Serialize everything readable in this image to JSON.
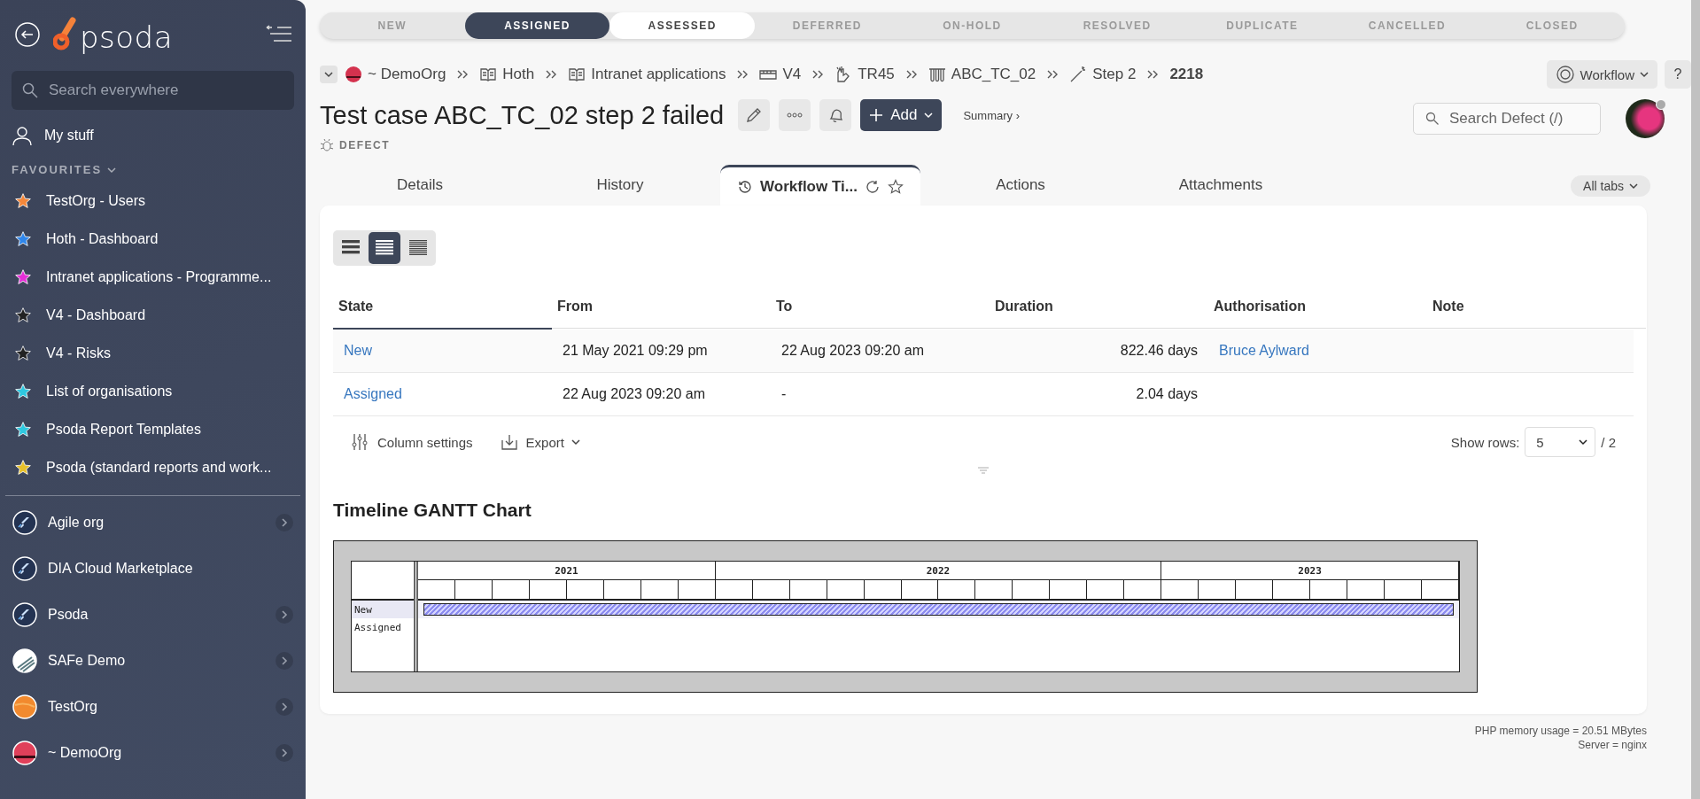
{
  "sidebar": {
    "logo": "psoda",
    "search": {
      "placeholder": "Search everywhere"
    },
    "my_stuff": "My stuff",
    "favourites_heading": "FAVOURITES",
    "favourites": [
      {
        "label": "TestOrg - Users",
        "color": "#f5873a"
      },
      {
        "label": "Hoth - Dashboard",
        "color": "#2f86eb"
      },
      {
        "label": "Intranet applications - Programme...",
        "color": "#e62ed8"
      },
      {
        "label": "V4 - Dashboard",
        "color": "#222222"
      },
      {
        "label": "V4 - Risks",
        "color": "#222222"
      },
      {
        "label": "List of organisations",
        "color": "#2ec8e0"
      },
      {
        "label": "Psoda Report Templates",
        "color": "#2ec8e0"
      },
      {
        "label": "Psoda (standard reports and work...",
        "color": "#e8c12a"
      }
    ],
    "organisations": [
      {
        "label": "Agile org",
        "kind": "rocket",
        "expandable": true
      },
      {
        "label": "DIA Cloud Marketplace",
        "kind": "rocket",
        "expandable": false
      },
      {
        "label": "Psoda",
        "kind": "rocket",
        "expandable": true
      },
      {
        "label": "SAFe Demo",
        "kind": "stripes",
        "expandable": true
      },
      {
        "label": "TestOrg",
        "kind": "orange",
        "expandable": true
      },
      {
        "label": "~ DemoOrg",
        "kind": "sunset",
        "expandable": true
      }
    ]
  },
  "workflow_steps": [
    {
      "label": "NEW",
      "kind": "past"
    },
    {
      "label": "ASSIGNED",
      "kind": "current"
    },
    {
      "label": "ASSESSED",
      "kind": "next"
    },
    {
      "label": "DEFERRED",
      "kind": "future"
    },
    {
      "label": "ON-HOLD",
      "kind": "future"
    },
    {
      "label": "RESOLVED",
      "kind": "future"
    },
    {
      "label": "DUPLICATE",
      "kind": "future"
    },
    {
      "label": "CANCELLED",
      "kind": "future"
    },
    {
      "label": "CLOSED",
      "kind": "future"
    }
  ],
  "breadcrumbs": [
    {
      "label": "~ DemoOrg",
      "kind": "org"
    },
    {
      "label": "Hoth",
      "kind": "book"
    },
    {
      "label": "Intranet applications",
      "kind": "book"
    },
    {
      "label": "V4",
      "kind": "board"
    },
    {
      "label": "TR45",
      "kind": "hand"
    },
    {
      "label": "ABC_TC_02",
      "kind": "tubes"
    },
    {
      "label": "Step 2",
      "kind": "wand"
    },
    {
      "label": "2218",
      "kind": "current"
    }
  ],
  "header": {
    "title": "Test case ABC_TC_02 step 2 failed",
    "type_label": "DEFECT",
    "add_button": "Add",
    "summary_link": "Summary ›",
    "workflow_button": "Workflow",
    "help_button": "?",
    "search": {
      "placeholder": "Search Defect (/)"
    }
  },
  "tabs": [
    {
      "label": "Details",
      "selected": false
    },
    {
      "label": "History",
      "selected": false
    },
    {
      "label": "Workflow Ti...",
      "selected": true
    },
    {
      "label": "Actions",
      "selected": false
    },
    {
      "label": "Attachments",
      "selected": false
    }
  ],
  "all_tabs_button": "All tabs",
  "view_modes": [
    {
      "selected": false
    },
    {
      "selected": true
    },
    {
      "selected": false
    }
  ],
  "table": {
    "columns": [
      "State",
      "From",
      "To",
      "Duration",
      "Authorisation",
      "Note"
    ],
    "rows": [
      {
        "state": "New",
        "from": "21 May 2021 09:29 pm",
        "to": "22 Aug 2023 09:20 am",
        "duration": "822.46 days",
        "authorisation": "Bruce Aylward"
      },
      {
        "state": "Assigned",
        "from": "22 Aug 2023 09:20 am",
        "to": "-",
        "duration": "2.04 days"
      }
    ]
  },
  "table_footer": {
    "column_settings": "Column settings",
    "export": "Export",
    "show_rows_label": "Show rows:",
    "show_rows_value": "5",
    "page_count": "/ 2"
  },
  "gantt": {
    "title": "Timeline GANTT Chart",
    "years": [
      "2021",
      "2022",
      "2023"
    ],
    "rows": [
      {
        "label": "New",
        "bar": true
      },
      {
        "label": "Assigned",
        "bar": false
      }
    ]
  },
  "footer": {
    "memory": "PHP memory usage = 20.51 MBytes",
    "server": "Server = nginx"
  }
}
